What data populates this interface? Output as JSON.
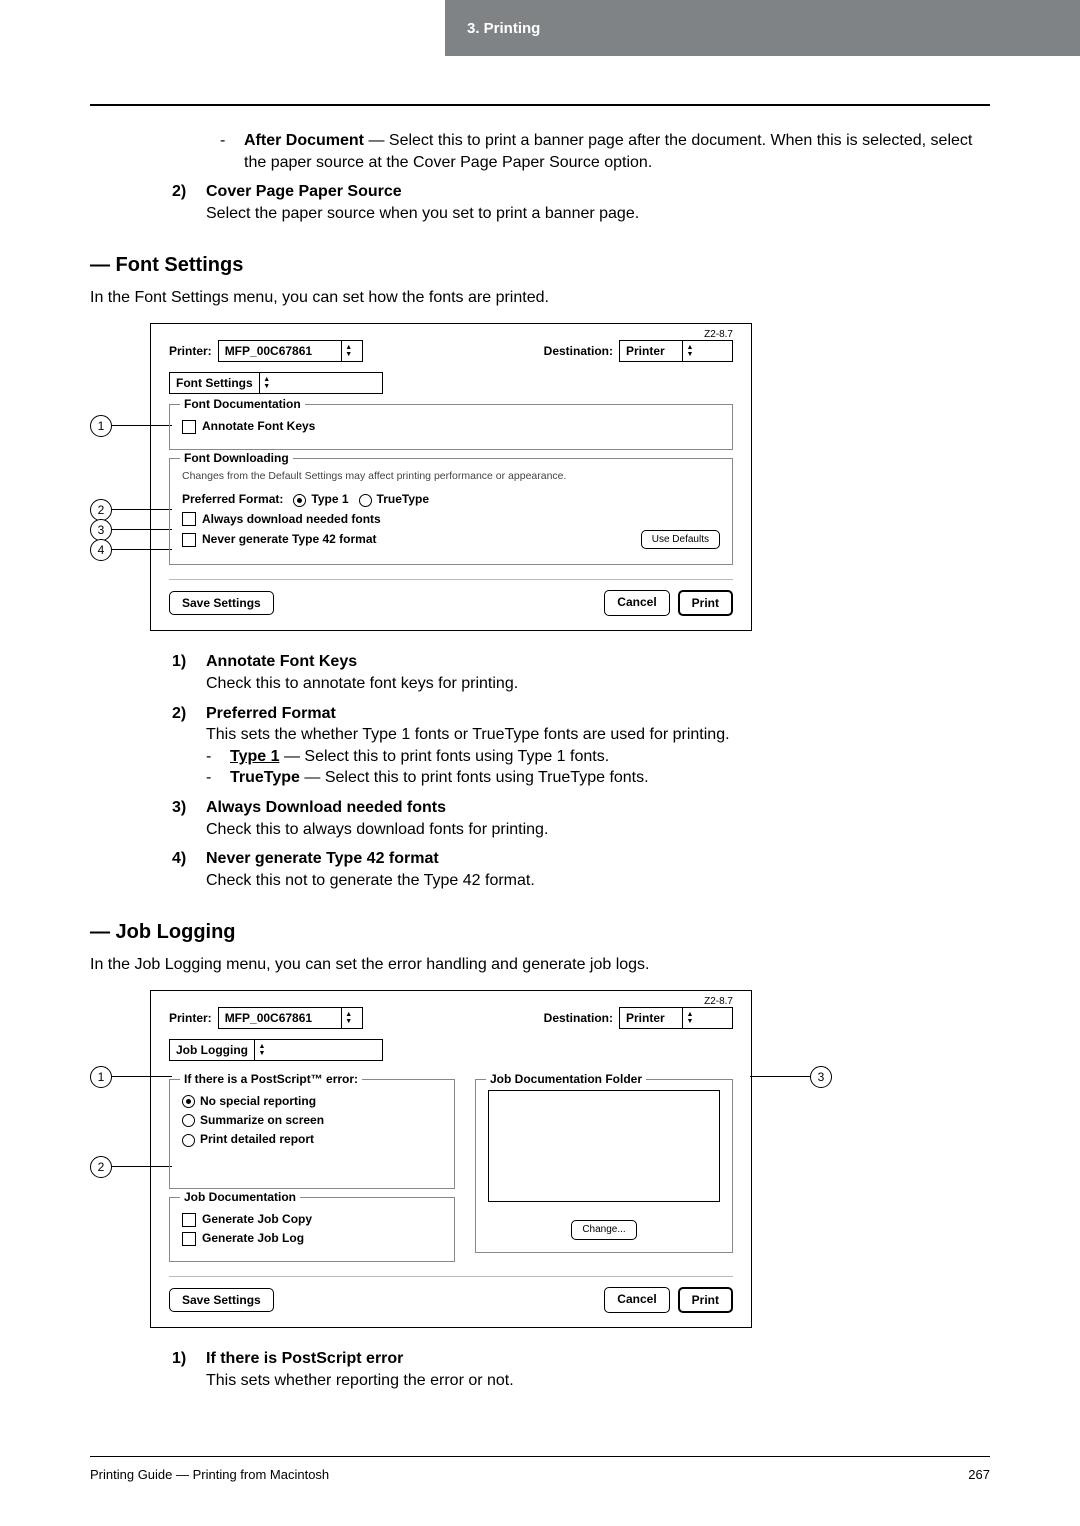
{
  "header": {
    "chapter": "3. Printing"
  },
  "afterDocument": {
    "term": "After Document",
    "desc": " — Select this to print a banner page after the document. When this is selected, select the paper source at the Cover Page Paper Source option."
  },
  "coverPagePaperSource": {
    "num": "2)",
    "title": "Cover Page Paper Source",
    "desc": "Select the paper source when you set to print a banner page."
  },
  "fontSettings": {
    "heading": "— Font Settings",
    "intro": "In the Font Settings menu, you can set how the fonts are printed.",
    "dialog": {
      "zlabel": "Z2-8.7",
      "printerLabel": "Printer:",
      "printerValue": "MFP_00C67861",
      "destLabel": "Destination:",
      "destValue": "Printer",
      "panel": "Font Settings",
      "group1": {
        "title": "Font Documentation",
        "annotate": "Annotate Font Keys"
      },
      "group2": {
        "title": "Font Downloading",
        "note": "Changes from the Default Settings may affect printing performance or appearance.",
        "prefLabel": "Preferred Format:",
        "type1": "Type 1",
        "truetype": "TrueType",
        "always": "Always download needed fonts",
        "never": "Never generate Type 42 format",
        "useDefaults": "Use Defaults"
      },
      "save": "Save Settings",
      "cancel": "Cancel",
      "print": "Print"
    },
    "items": [
      {
        "num": "1)",
        "title": "Annotate Font Keys",
        "desc": "Check this to annotate font keys for printing."
      },
      {
        "num": "2)",
        "title": "Preferred Format",
        "desc": "This sets the whether Type 1 fonts or TrueType fonts are used for printing.",
        "sub": [
          {
            "term": "Type 1",
            "desc": " — Select this to print fonts using Type 1 fonts.",
            "underline": true
          },
          {
            "term": "TrueType",
            "desc": " — Select this to print fonts using TrueType fonts."
          }
        ]
      },
      {
        "num": "3)",
        "title": "Always Download needed fonts",
        "desc": "Check this to always download fonts for printing."
      },
      {
        "num": "4)",
        "title": "Never generate Type 42 format",
        "desc": "Check this not to generate the Type 42 format."
      }
    ]
  },
  "jobLogging": {
    "heading": "— Job Logging",
    "intro": "In the Job Logging menu, you can set the error handling and generate job logs.",
    "dialog": {
      "zlabel": "Z2-8.7",
      "printerLabel": "Printer:",
      "printerValue": "MFP_00C67861",
      "destLabel": "Destination:",
      "destValue": "Printer",
      "panel": "Job Logging",
      "psGroup": {
        "title": "If there is a PostScript™ error:",
        "opt1": "No special reporting",
        "opt2": "Summarize on screen",
        "opt3": "Print detailed report"
      },
      "docGroup": {
        "title": "Job Documentation",
        "copy": "Generate Job Copy",
        "log": "Generate Job Log"
      },
      "folderTitle": "Job Documentation Folder",
      "change": "Change...",
      "save": "Save Settings",
      "cancel": "Cancel",
      "print": "Print"
    },
    "items": [
      {
        "num": "1)",
        "title": "If there is PostScript error",
        "desc": "This sets whether reporting the error or not."
      }
    ]
  },
  "footer": {
    "left": "Printing Guide — Printing from Macintosh",
    "page": "267"
  }
}
